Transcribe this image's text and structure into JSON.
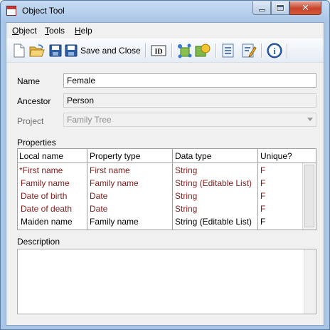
{
  "window": {
    "title": "Object Tool",
    "close_glyph": "✕"
  },
  "menu": [
    {
      "accel": "O",
      "rest": "bject"
    },
    {
      "accel": "T",
      "rest": "ools"
    },
    {
      "accel": "H",
      "rest": "elp"
    }
  ],
  "toolbar": {
    "save_and_close": "Save and Close",
    "id_label": "ID",
    "info_glyph": "i"
  },
  "form": {
    "name_label": "Name",
    "name_value": "Female",
    "ancestor_label": "Ancestor",
    "ancestor_value": "Person",
    "project_label": "Project",
    "project_value": "Family Tree",
    "properties_label": "Properties",
    "description_label": "Description",
    "description_value": ""
  },
  "properties": {
    "columns": [
      "Local name",
      "Property type",
      "Data type",
      "Unique?"
    ],
    "rows": [
      {
        "local": "*First name",
        "ptype": "First name",
        "dtype": "String",
        "unique": "F",
        "inherited": true
      },
      {
        "local": "Family name",
        "ptype": "Family name",
        "dtype": "String (Editable List)",
        "unique": "F",
        "inherited": true
      },
      {
        "local": "Date of birth",
        "ptype": "Date",
        "dtype": "String",
        "unique": "F",
        "inherited": true
      },
      {
        "local": "Date of death",
        "ptype": "Date",
        "dtype": "String",
        "unique": "F",
        "inherited": true
      },
      {
        "local": "Maiden name",
        "ptype": "Family name",
        "dtype": "String (Editable List)",
        "unique": "F",
        "inherited": false
      }
    ]
  },
  "colors": {
    "inherited_text": "#7f1b1b",
    "accent": "#1f5fa8"
  }
}
